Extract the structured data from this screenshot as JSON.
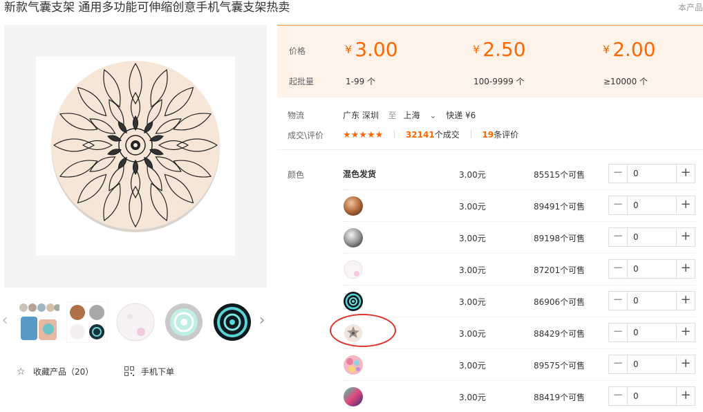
{
  "product": {
    "title": "新款气囊支架 通用多功能可伸缩创意手机气囊支架热卖",
    "title_right": "本产品"
  },
  "gallery": {
    "thumbs": [
      "thumb-collage",
      "thumb-grid",
      "thumb-white-pink",
      "thumb-mint-mandala",
      "thumb-teal-mandala"
    ]
  },
  "actions": {
    "favorite_label": "收藏产品（20）",
    "mobile_order_label": "手机下单"
  },
  "price_panel": {
    "price_label": "价格",
    "moq_label": "起批量",
    "currency": "¥",
    "tiers": [
      {
        "price": "3.00",
        "qty": "1-99 个"
      },
      {
        "price": "2.50",
        "qty": "100-9999 个"
      },
      {
        "price": "2.00",
        "qty": "≥10000 个"
      }
    ]
  },
  "shipping": {
    "label": "物流",
    "from": "广东 深圳",
    "to_word": "至",
    "to": "上海",
    "method": "快递 ¥6"
  },
  "reviews": {
    "label": "成交\\评价",
    "stars": "★★★★★",
    "deals_count": "32141",
    "deals_suffix": "个成交",
    "review_count": "19",
    "review_suffix": "条评价"
  },
  "sku": {
    "label": "颜色",
    "rows": [
      {
        "name": "混色发货",
        "swatch": "",
        "price": "3.00元",
        "stock": "85515个可售",
        "qty": "0"
      },
      {
        "name": "",
        "swatch": "copper",
        "price": "3.00元",
        "stock": "89491个可售",
        "qty": "0"
      },
      {
        "name": "",
        "swatch": "silver",
        "price": "3.00元",
        "stock": "89198个可售",
        "qty": "0"
      },
      {
        "name": "",
        "swatch": "white-pink",
        "price": "3.00元",
        "stock": "87201个可售",
        "qty": "0"
      },
      {
        "name": "",
        "swatch": "teal-mandala",
        "price": "3.00元",
        "stock": "86906个可售",
        "qty": "0"
      },
      {
        "name": "",
        "swatch": "beige-mandala",
        "price": "3.00元",
        "stock": "88429个可售",
        "qty": "0"
      },
      {
        "name": "",
        "swatch": "floral",
        "price": "3.00元",
        "stock": "89575个可售",
        "qty": "0"
      },
      {
        "name": "",
        "swatch": "galaxy",
        "price": "3.00元",
        "stock": "88419个可售",
        "qty": "0"
      }
    ]
  },
  "colors": {
    "accent": "#ff6600",
    "highlight": "#e0302b"
  }
}
